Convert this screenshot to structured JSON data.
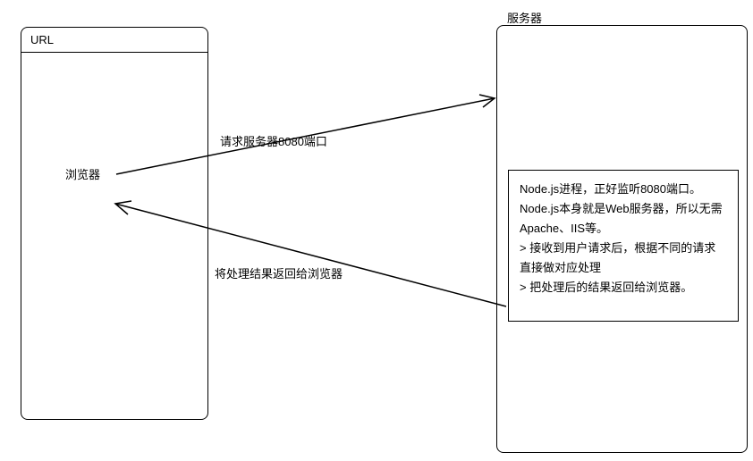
{
  "left_box": {
    "url_label": "URL",
    "browser_label": "浏览器"
  },
  "right_box": {
    "server_label": "服务器",
    "inner": {
      "line1": "Node.js进程，正好监听8080端口。Node.js本身就是Web服务器，所以无需Apache、IIS等。",
      "line2": "> 接收到用户请求后，根据不同的请求直接做对应处理",
      "line3": "> 把处理后的结果返回给浏览器。"
    }
  },
  "arrows": {
    "request_label": "请求服务器8080端口",
    "response_label": "将处理结果返回给浏览器"
  }
}
